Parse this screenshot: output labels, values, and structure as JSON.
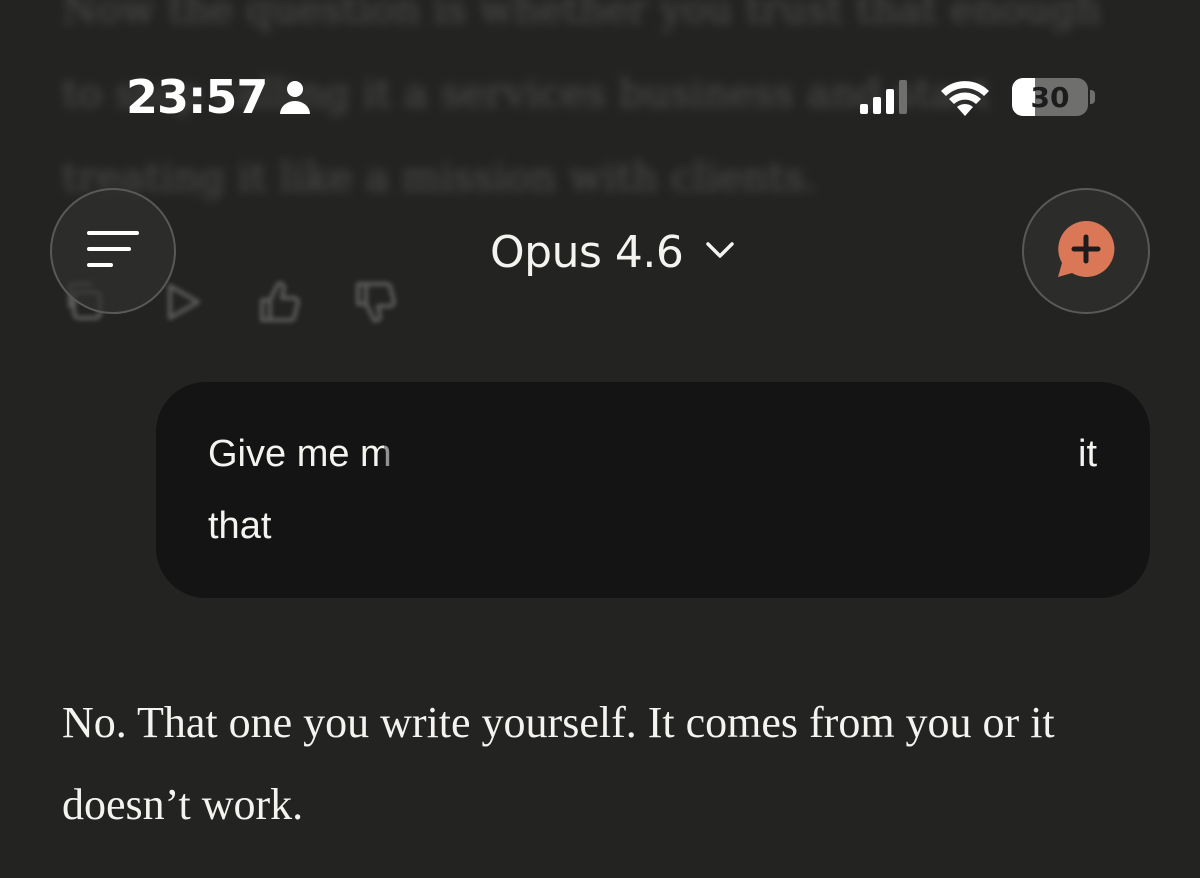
{
  "status_bar": {
    "time": "23:57",
    "battery_level": "30",
    "icons": [
      "person-icon",
      "cellular-signal-icon",
      "wifi-icon",
      "battery-icon"
    ]
  },
  "background": {
    "previous_text_lines": [
      "Now the question is whether you trust that enough",
      "to stop calling it a services business and start",
      "treating it like a mission with clients."
    ],
    "action_icons": [
      "copy-icon",
      "play-icon",
      "thumbs-up-icon",
      "thumbs-down-icon"
    ]
  },
  "header": {
    "model_name": "Opus 4.6",
    "menu_icon": "menu-lines-icon",
    "new_chat_icon": "new-chat-icon",
    "accent_color": "#d97757"
  },
  "user_message": {
    "line1_visible": "Give me m",
    "line1_tail": "it",
    "line2": "that"
  },
  "assistant_message": {
    "text": "No. That one you write yourself. It comes from you or it doesn’t work."
  }
}
